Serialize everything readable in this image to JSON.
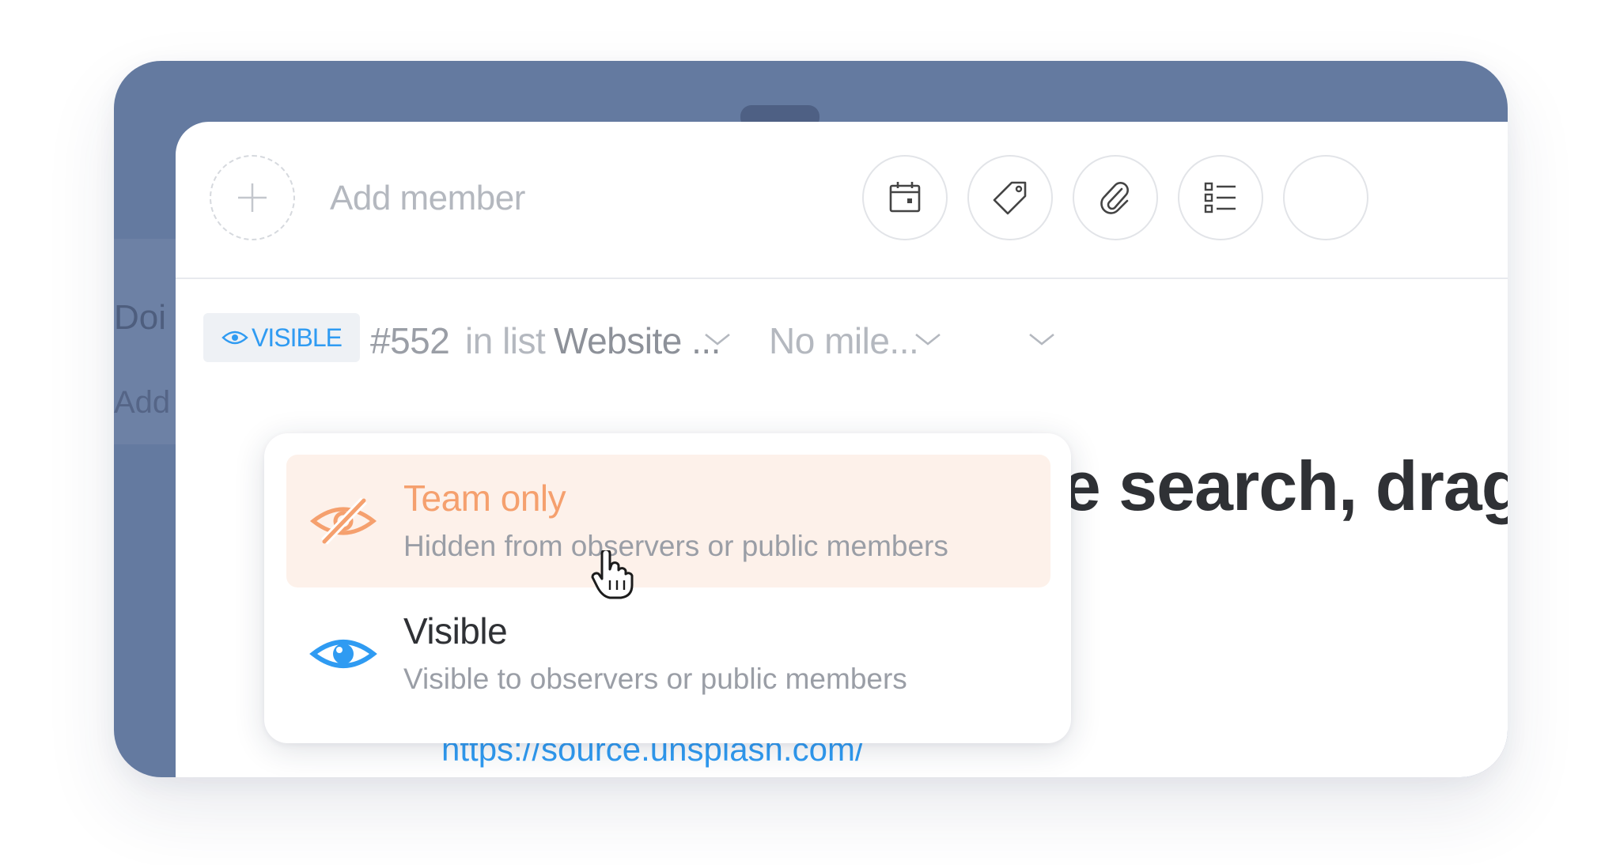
{
  "background": {
    "column_label": "Doi",
    "add_label": "Add"
  },
  "header": {
    "add_member_placeholder": "Add member",
    "tools": [
      {
        "icon": "calendar-icon"
      },
      {
        "icon": "tag-icon"
      },
      {
        "icon": "paperclip-icon"
      },
      {
        "icon": "checklist-icon"
      }
    ]
  },
  "meta": {
    "visibility_badge": "VISIBLE",
    "card_number": "#552",
    "in_list_label": "in list",
    "list_name": "Website ...",
    "milestone": "No mile..."
  },
  "card": {
    "title_fragment": "ge search, drag",
    "link": "https://source.unsplash.com/"
  },
  "visibility_menu": {
    "options": [
      {
        "title": "Team only",
        "description": "Hidden from observers or public members",
        "icon": "eye-slash-icon",
        "color": "#f5a06e",
        "highlighted": true
      },
      {
        "title": "Visible",
        "description": "Visible to observers or public members",
        "icon": "eye-icon",
        "color": "#2f9bf2",
        "highlighted": false
      }
    ]
  },
  "colors": {
    "accent_blue": "#2f9bf2",
    "accent_orange": "#f5a06e",
    "frame_blue": "#647aa0"
  }
}
